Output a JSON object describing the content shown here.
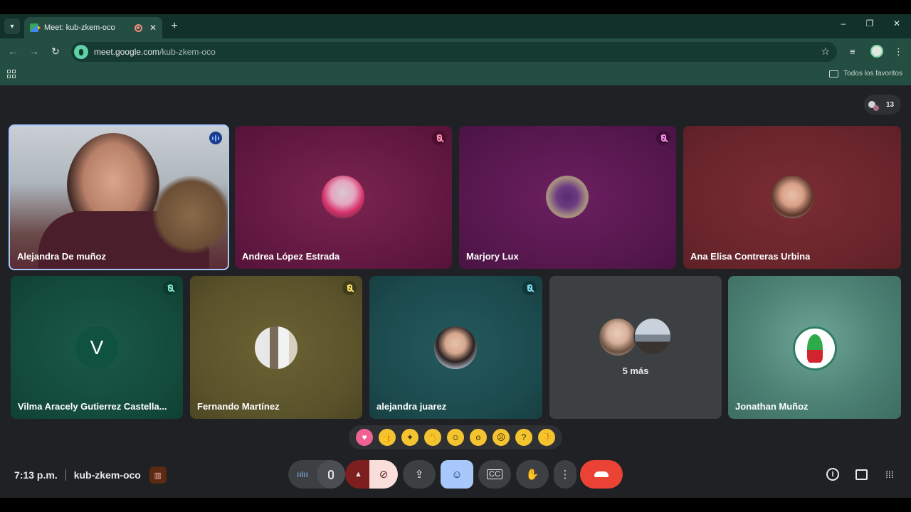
{
  "browser": {
    "tab_title": "Meet: kub-zkem-oco",
    "url_host": "meet.google.com",
    "url_path": "/kub-zkem-oco",
    "bookmarks_folder": "Todos los favoritos"
  },
  "meeting": {
    "participant_count": "13",
    "time": "7:13 p.m.",
    "code": "kub-zkem-oco"
  },
  "tiles": [
    {
      "name": "Alejandra De muñoz"
    },
    {
      "name": "Andrea López Estrada"
    },
    {
      "name": "Marjory Lux"
    },
    {
      "name": "Ana Elisa Contreras Urbina"
    },
    {
      "name": "Vilma Aracely Gutierrez Castella...",
      "initial": "V"
    },
    {
      "name": "Fernando Martínez"
    },
    {
      "name": "alejandra juarez"
    },
    {
      "name": "5 más"
    },
    {
      "name": "Jonathan Muñoz"
    }
  ],
  "reactions": [
    "heart-icon",
    "thumbs-up-icon",
    "party-icon",
    "clap-icon",
    "laugh-icon",
    "surprised-icon",
    "sad-icon",
    "thinking-icon",
    "thumbs-down-icon"
  ],
  "colors": {
    "tab_strip": "#11312a",
    "toolbar": "#254e42",
    "meet_bg": "#202124",
    "end_call": "#ea4335",
    "reactions_active": "#a8c7fa"
  }
}
